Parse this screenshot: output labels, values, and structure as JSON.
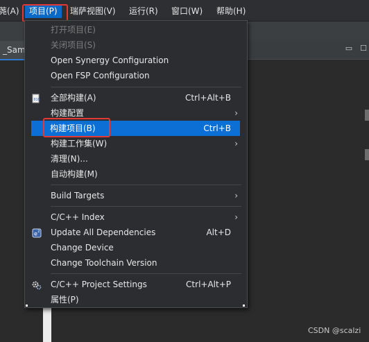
{
  "menubar": {
    "items": [
      {
        "label": "荛(A)"
      },
      {
        "label": "项目(P)"
      },
      {
        "label": "瑞萨视图(V)"
      },
      {
        "label": "运行(R)"
      },
      {
        "label": "窗口(W)"
      },
      {
        "label": "帮助(H)"
      }
    ]
  },
  "editor": {
    "tab_label": "_Samp",
    "window_controls": [
      "▭",
      "☐"
    ]
  },
  "menu": {
    "items": [
      {
        "label": "打开项目(E)",
        "disabled": true
      },
      {
        "label": "关闭项目(S)",
        "disabled": true
      },
      {
        "label": "Open Synergy Configuration"
      },
      {
        "label": "Open FSP Configuration"
      },
      {
        "label": "全部构建(A)",
        "shortcut": "Ctrl+Alt+B",
        "icon": "build-all-icon"
      },
      {
        "label": "构建配置",
        "submenu": true
      },
      {
        "label": "构建项目(B)",
        "shortcut": "Ctrl+B",
        "selected": true
      },
      {
        "label": "构建工作集(W)",
        "submenu": true
      },
      {
        "label": "清理(N)..."
      },
      {
        "label": "自动构建(M)"
      },
      {
        "label": "Build Targets",
        "submenu": true
      },
      {
        "label": "C/C++ Index",
        "submenu": true
      },
      {
        "label": "Update All Dependencies",
        "shortcut": "Alt+D",
        "icon": "dependencies-icon"
      },
      {
        "label": "Change Device"
      },
      {
        "label": "Change Toolchain Version"
      },
      {
        "label": "C/C++ Project Settings",
        "shortcut": "Ctrl+Alt+P",
        "icon": "settings-gears-icon"
      },
      {
        "label": "属性(P)"
      }
    ],
    "submenu_arrow": "›"
  },
  "watermark": "CSDN @scalzi"
}
